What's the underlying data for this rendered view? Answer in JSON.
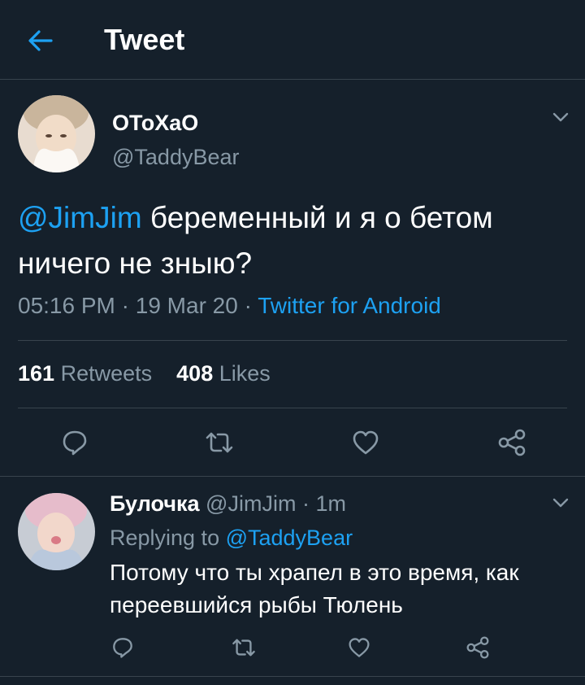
{
  "header": {
    "title": "Tweet",
    "back_icon": "arrow-left-icon"
  },
  "colors": {
    "background": "#15202b",
    "accent": "#1da1f2",
    "muted": "#8899a6",
    "divider": "#38444d"
  },
  "tweet": {
    "author_name": "ОТоXaО",
    "author_handle": "@TaddyBear",
    "text_mention": "@JimJim",
    "text_body": " беременный и я о бетом ничего не зныю?",
    "time": "05:16 PM",
    "sep1": " · ",
    "date": "19 Mar 20",
    "sep2": " · ",
    "source": "Twitter for Android",
    "retweets_count": "161",
    "retweets_label": "Retweets",
    "likes_count": "408",
    "likes_label": "Likes"
  },
  "reply": {
    "author_name": "Булочка",
    "author_handle": "@JimJim",
    "time_sep": " · ",
    "time": "1m",
    "replying_label": "Replying to ",
    "replying_handle": "@TaddyBear",
    "text": "Потому что ты храпел в это время, как переевшийся рыбы Тюлень"
  }
}
